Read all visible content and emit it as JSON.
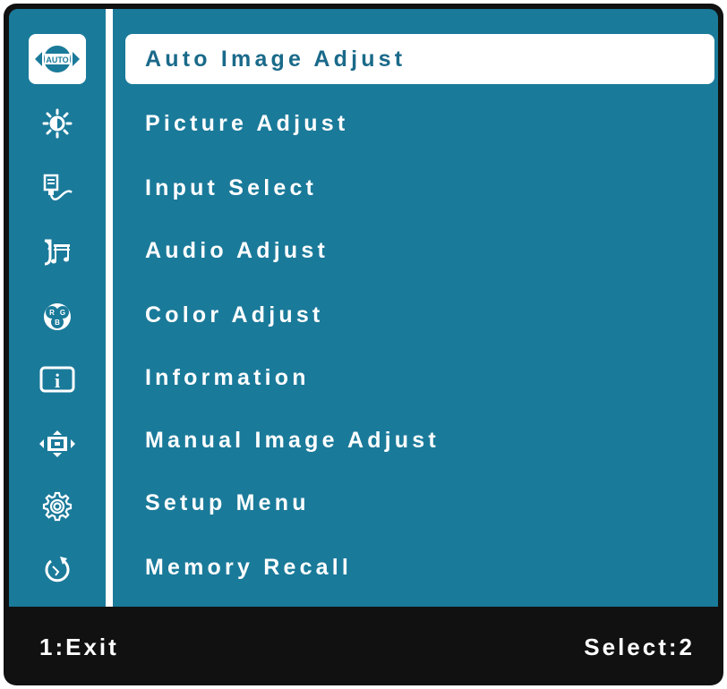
{
  "menu": {
    "items": [
      {
        "label": "Auto Image Adjust",
        "icon": "auto-icon",
        "selected": true
      },
      {
        "label": "Picture Adjust",
        "icon": "brightness-icon",
        "selected": false
      },
      {
        "label": "Input Select",
        "icon": "input-icon",
        "selected": false
      },
      {
        "label": "Audio Adjust",
        "icon": "audio-icon",
        "selected": false
      },
      {
        "label": "Color Adjust",
        "icon": "rgb-icon",
        "selected": false
      },
      {
        "label": "Information",
        "icon": "info-icon",
        "selected": false
      },
      {
        "label": "Manual Image Adjust",
        "icon": "manual-image-icon",
        "selected": false
      },
      {
        "label": "Setup Menu",
        "icon": "gear-icon",
        "selected": false
      },
      {
        "label": "Memory Recall",
        "icon": "recall-icon",
        "selected": false
      }
    ]
  },
  "icon_glyphs": {
    "auto_text": "AUTO",
    "rgb_r": "R",
    "rgb_g": "G",
    "rgb_b": "B",
    "info_i": "i"
  },
  "footer": {
    "exit_label": "1:Exit",
    "select_label": "Select:2"
  },
  "colors": {
    "panel_blue": "#1a7a9a",
    "frame_black": "#111111",
    "highlight_white": "#ffffff",
    "selected_text": "#1a6a8a"
  }
}
